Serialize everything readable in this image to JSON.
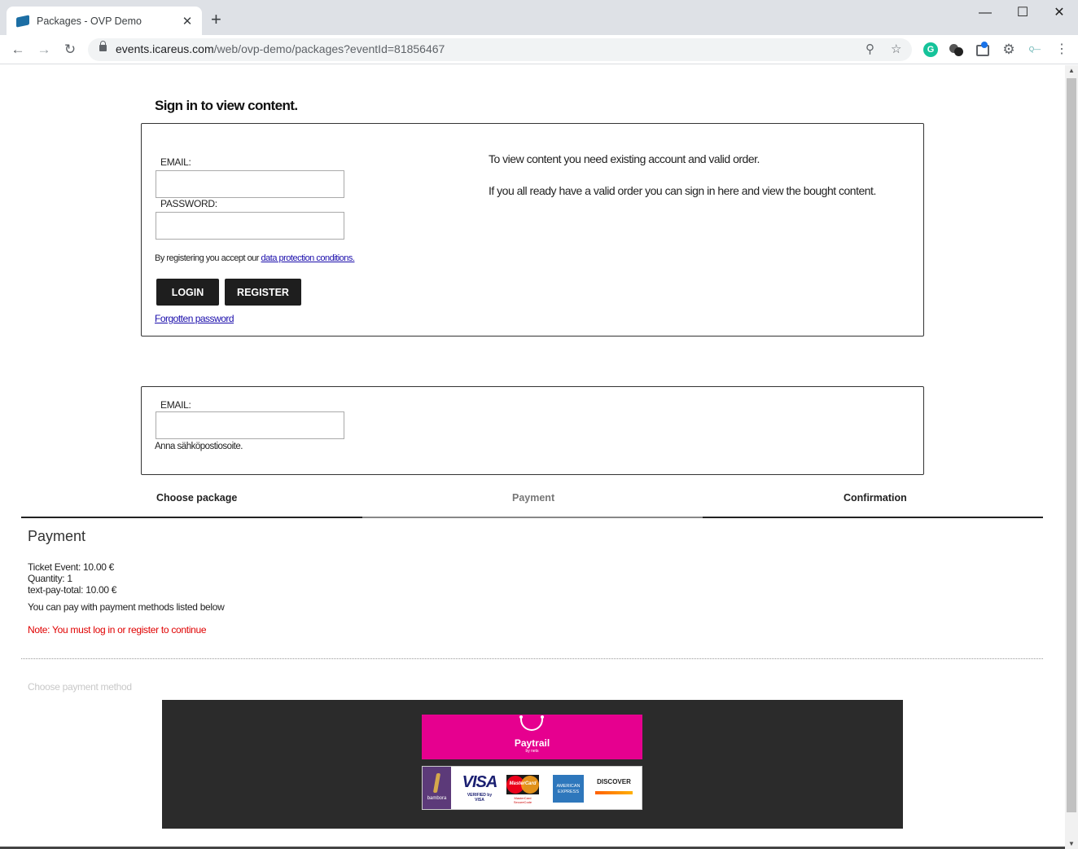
{
  "browser": {
    "tab_title": "Packages - OVP Demo",
    "close_tab": "✕",
    "new_tab": "+",
    "url_host": "events.icareus.com",
    "url_path": "/web/ovp-demo/packages?eventId=81856467",
    "window_controls": {
      "minimize": "—",
      "maximize": "☐",
      "close": "✕"
    },
    "extension_icons": [
      "grammarly-icon",
      "extension-icon",
      "bookmark-manager-icon",
      "puzzle-icon",
      "qmee-icon"
    ]
  },
  "signin": {
    "heading": "Sign in to view content.",
    "email_label": "EMAIL:",
    "email_value": "",
    "password_label": "PASSWORD:",
    "password_value": "",
    "terms_prefix": "By registering you accept our ",
    "terms_link": "data protection conditions.",
    "login_label": "LOGIN",
    "register_label": "REGISTER",
    "forgot_label": "Forgotten password",
    "info_line1": "To view content you need existing account and valid order.",
    "info_line2": "If you all ready have a valid order you can sign in here and view the bought content."
  },
  "guest": {
    "email_label": "EMAIL:",
    "email_value": "",
    "hint": "Anna sähköpostiosoite."
  },
  "steps": {
    "items": [
      "Choose package",
      "Payment",
      "Confirmation"
    ],
    "active": "Payment"
  },
  "payment": {
    "title": "Payment",
    "ticket": "Ticket Event: 10.00 €",
    "quantity": "Quantity: 1",
    "total": "text-pay-total: 10.00 €",
    "methods_text": "You can pay with payment methods listed below",
    "note": "Note: You must log in or register to continue",
    "choose_method": "Choose payment method",
    "provider_name": "Paytrail",
    "provider_sub": "by nets",
    "cards": {
      "bambora": "bambora",
      "visa": "VISA",
      "visa_sub": "VERIFIED by VISA",
      "mastercard": "MasterCard",
      "mastercard_sub": "MasterCard SecureCode",
      "amex": "AMERICAN EXPRESS",
      "discover": "DISCOVER"
    },
    "colors": {
      "paytrail": "#e6008f",
      "panel": "#2b2b2b",
      "note": "#e00000"
    }
  }
}
